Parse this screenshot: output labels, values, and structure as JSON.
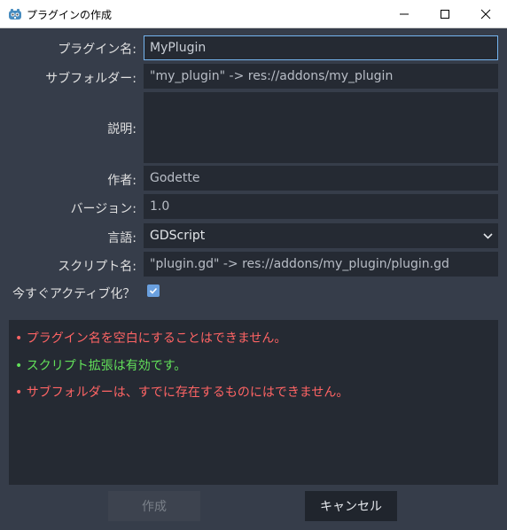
{
  "window": {
    "title": "プラグインの作成",
    "icon": "godot-icon",
    "controls": [
      "minimize-icon",
      "maximize-icon",
      "close-icon"
    ]
  },
  "form": {
    "plugin_name": {
      "label": "プラグイン名:",
      "value": "MyPlugin"
    },
    "subfolder": {
      "label": "サブフォルダー:",
      "value": "\"my_plugin\" -> res://addons/my_plugin"
    },
    "description": {
      "label": "説明:",
      "value": ""
    },
    "author": {
      "label": "作者:",
      "value": "Godette"
    },
    "version": {
      "label": "バージョン:",
      "value": "1.0"
    },
    "language": {
      "label": "言語:",
      "value": "GDScript"
    },
    "script_name": {
      "label": "スクリプト名:",
      "value": "\"plugin.gd\" -> res://addons/my_plugin/plugin.gd"
    },
    "activate": {
      "label": "今すぐアクティブ化？",
      "checked": true
    }
  },
  "messages": [
    {
      "text": "• プラグイン名を空白にすることはできません。",
      "status": "error"
    },
    {
      "text": "• スクリプト拡張は有効です。",
      "status": "ok"
    },
    {
      "text": "• サブフォルダーは、すでに存在するものにはできません。",
      "status": "error"
    }
  ],
  "buttons": {
    "create": "作成",
    "cancel": "キャンセル"
  },
  "colors": {
    "background": "#363d4a",
    "field": "#252a33",
    "focus": "#75b5f0",
    "error": "#ff6464",
    "success": "#62e05a",
    "accent": "#6aa0df"
  }
}
